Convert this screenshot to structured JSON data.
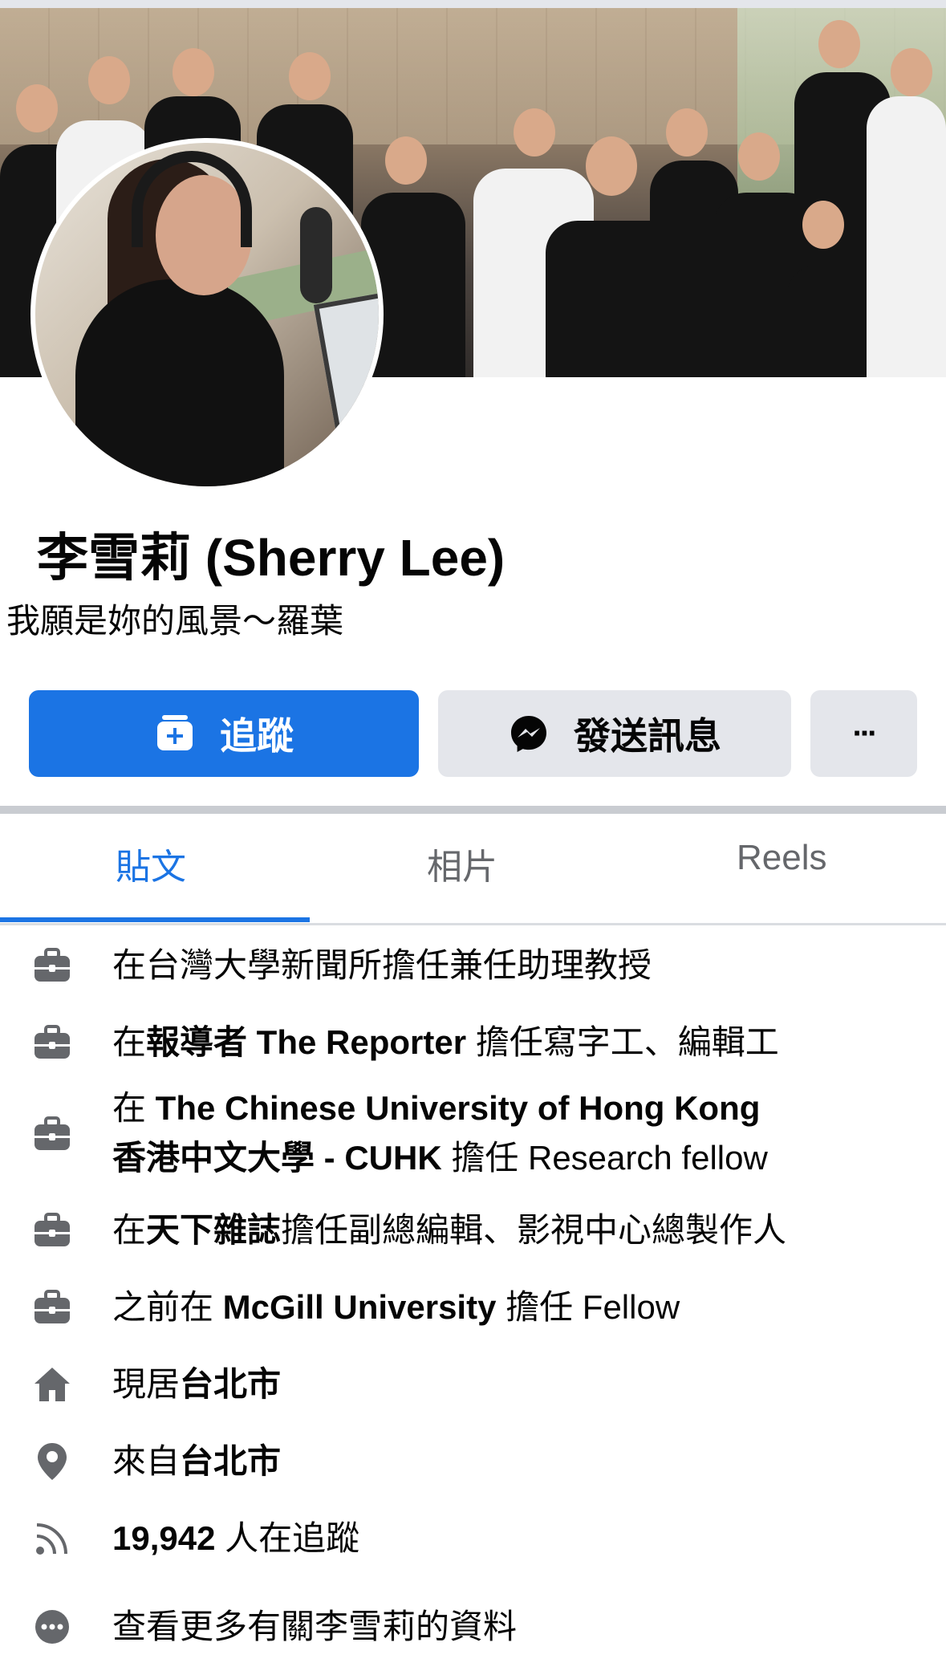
{
  "profile": {
    "name": "李雪莉 (Sherry Lee)",
    "bio": "我願是妳的風景～羅葉"
  },
  "actions": {
    "follow_label": "追蹤",
    "message_label": "發送訊息",
    "more_label": "···"
  },
  "tabs": [
    {
      "label": "貼文",
      "active": true
    },
    {
      "label": "相片",
      "active": false
    },
    {
      "label": "Reels",
      "active": false
    }
  ],
  "details": {
    "work1": {
      "prefix": "在台灣大學新聞所擔任兼任助理教授"
    },
    "work2": {
      "prefix": "在",
      "org": "報導者 The Reporter",
      "suffix": " 擔任寫字工、編輯工"
    },
    "work3": {
      "prefix": "在 ",
      "org_line1": "The Chinese University of Hong Kong",
      "org_line2": "香港中文大學 - CUHK",
      "suffix": " 擔任 Research fellow"
    },
    "work4": {
      "prefix": "在",
      "org": "天下雜誌",
      "suffix": "擔任副總編輯、影視中心總製作人"
    },
    "work5": {
      "prefix": "之前在 ",
      "org": "McGill University",
      "suffix": " 擔任 Fellow"
    },
    "lives": {
      "prefix": "現居",
      "place": "台北市"
    },
    "from": {
      "prefix": "來自",
      "place": "台北市"
    },
    "followers": {
      "count": "19,942",
      "suffix": " 人在追蹤"
    },
    "more": {
      "label": "查看更多有關李雪莉的資料"
    }
  },
  "colors": {
    "accent": "#1b74e4",
    "button_gray": "#e4e6eb",
    "secondary_text": "#65676b"
  },
  "icons": [
    "briefcase-icon",
    "home-icon",
    "location-pin-icon",
    "rss-followers-icon",
    "more-dots-icon",
    "add-friend-icon",
    "messenger-icon"
  ]
}
